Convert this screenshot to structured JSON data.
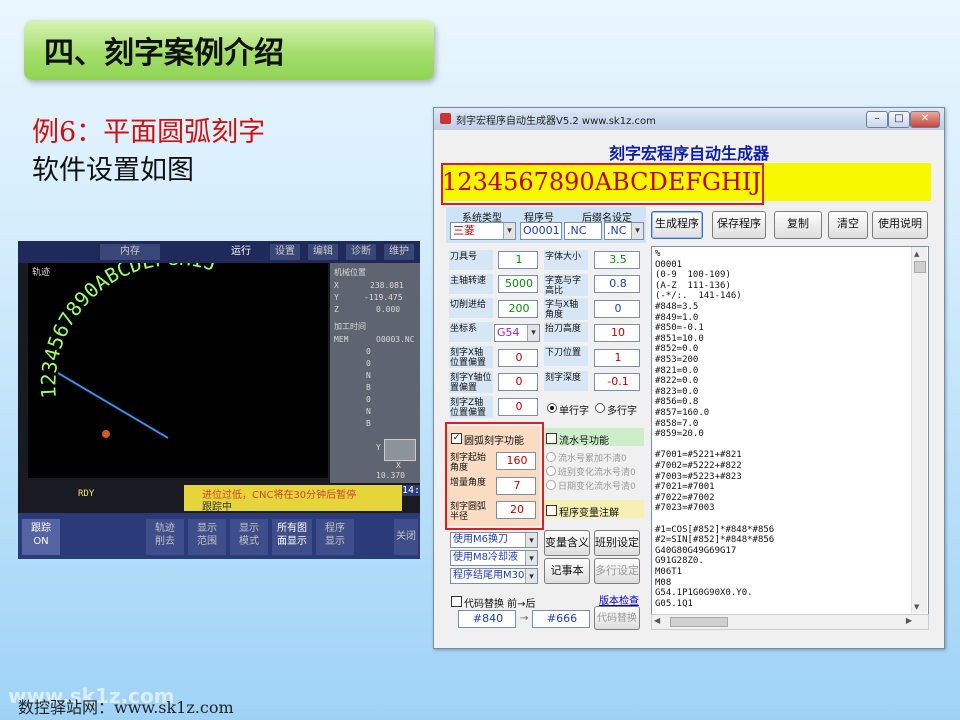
{
  "slide": {
    "title": "四、刻字案例介绍",
    "example_title": "例6：平面圆弧刻字",
    "example_sub": "软件设置如图",
    "footer": "数控驿站网：www.sk1z.com",
    "watermark": "www.sk1z.com"
  },
  "cnc_photo": {
    "tabs": [
      "内存",
      "运行",
      "设置",
      "编辑",
      "诊断",
      "维护"
    ],
    "screen_label": "轨迹",
    "engraved_text": "1234567890ABCDEFGHIJ",
    "right_panel": {
      "header": "机械位置",
      "axes": [
        {
          "axis": "X",
          "value": "238.081"
        },
        {
          "axis": "Y",
          "value": "-119.475"
        },
        {
          "axis": "Z",
          "value": "0.000"
        }
      ],
      "section": "加工时间",
      "mem": "MEM",
      "prog": "O0003.NC",
      "bits": [
        "0",
        "0",
        "N",
        "B",
        "0",
        "N",
        "B"
      ],
      "y_label": "Y",
      "x_label": "X",
      "value": "10.370"
    },
    "status": "RDY",
    "message": "进位过低，CNC将在30分钟后暂停",
    "message2": "跟踪中",
    "clock": "14:5",
    "buttons": [
      "跟踪\nON",
      "轨迹\n削去",
      "显示\n范围",
      "显示\n模式",
      "所有图\n面显示",
      "程序\n显示",
      "关闭"
    ]
  },
  "window": {
    "title": "刻字宏程序自动生成器V5.2  www.sk1z.com",
    "heading": "刻字宏程序自动生成器",
    "text_to_engrave": "1234567890ABCDEFGHIJ",
    "config": {
      "labels": [
        "系统类型",
        "程序号",
        "后缀名设定"
      ],
      "system_type": "三菱",
      "program_no": "O0001",
      "suffix1": ".NC",
      "suffix2": ".NC"
    },
    "top_buttons": [
      "生成程序",
      "保存程序",
      "复制",
      "清空",
      "使用说明"
    ],
    "params_left": [
      {
        "label": "刀具号",
        "value": "1"
      },
      {
        "label": "主轴转速",
        "value": "5000"
      },
      {
        "label": "切削进给",
        "value": "200"
      },
      {
        "label": "坐标系",
        "value": "G54"
      },
      {
        "label": "刻字X轴位置偏置",
        "value": "0"
      },
      {
        "label": "刻字Y轴位置偏置",
        "value": "0"
      },
      {
        "label": "刻字Z轴位置偏置",
        "value": "0"
      }
    ],
    "params_right": [
      {
        "label": "字体大小",
        "value": "3.5"
      },
      {
        "label": "字宽与字高比",
        "value": "0.8"
      },
      {
        "label": "字与X轴角度",
        "value": "0"
      },
      {
        "label": "抬刀高度",
        "value": "10"
      },
      {
        "label": "下刀位置",
        "value": "1"
      },
      {
        "label": "刻字深度",
        "value": "-0.1"
      }
    ],
    "row_options": [
      "单行字",
      "多行字"
    ],
    "arc": {
      "checkbox": "圆弧刻字功能",
      "checked": true,
      "params": [
        {
          "label": "刻字起始角度",
          "value": "160"
        },
        {
          "label": "增量角度",
          "value": "7"
        },
        {
          "label": "刻字圆弧半径",
          "value": "20"
        }
      ]
    },
    "serial": {
      "checkbox": "流水号功能",
      "options": [
        "流水号累加不清0",
        "班别变化流水号清0",
        "日期变化流水号清0"
      ]
    },
    "program_comment": "程序变量注解",
    "dropdowns": [
      "使用M6换刀",
      "使用M8冷却液",
      "程序结尾用M30"
    ],
    "side_buttons": [
      "变量含义",
      "班别设定",
      "记事本",
      "多行设定"
    ],
    "replace": {
      "checkbox": "代码替换 前→后",
      "link": "版本检查",
      "from": "#840",
      "to": "#666",
      "button": "代码替换"
    },
    "code_lines": [
      "%",
      "O0001",
      "(0-9  100-109)",
      "(A-Z  111-136)",
      "(-*/:.  141-146)",
      "#848=3.5",
      "#849=1.0",
      "#850=-0.1",
      "#851=10.0",
      "#852=0.0",
      "#853=200",
      "#821=0.0",
      "#822=0.0",
      "#823=0.0",
      "#856=0.8",
      "#857=160.0",
      "#858=7.0",
      "#859=20.0",
      "",
      "#7001=#5221+#821",
      "#7002=#5222+#822",
      "#7003=#5223+#823",
      "#7021=#7001",
      "#7022=#7002",
      "#7023=#7003",
      "",
      "#1=COS[#852]*#848*#856",
      "#2=SIN[#852]*#848*#856",
      "G40G80G49G69G17",
      "G91G28Z0.",
      "M06T1",
      "M08",
      "G54.1P1G0G90X0.Y0.",
      "G05.1Q1"
    ]
  }
}
